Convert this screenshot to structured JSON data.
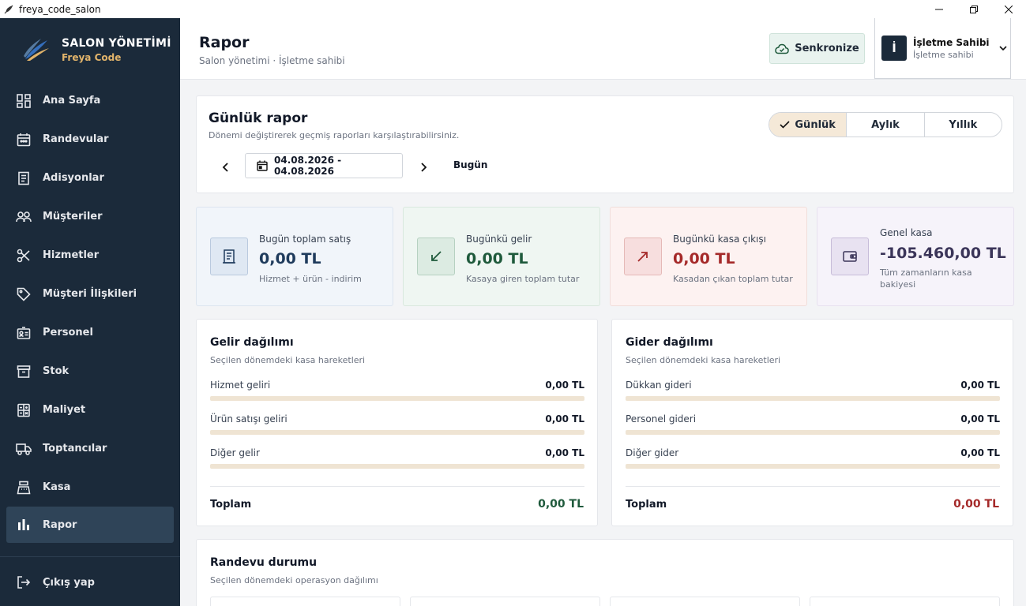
{
  "window": {
    "title": "freya_code_salon"
  },
  "brand": {
    "title": "SALON YÖNETİMİ",
    "subtitle": "Freya Code"
  },
  "sidebar": {
    "items": [
      {
        "label": "Ana Sayfa",
        "icon": "dashboard-icon"
      },
      {
        "label": "Randevular",
        "icon": "calendar-icon"
      },
      {
        "label": "Adisyonlar",
        "icon": "receipt-icon"
      },
      {
        "label": "Müşteriler",
        "icon": "users-icon"
      },
      {
        "label": "Hizmetler",
        "icon": "scissors-icon"
      },
      {
        "label": "Müşteri İlişkileri",
        "icon": "tag-icon"
      },
      {
        "label": "Personel",
        "icon": "id-card-icon"
      },
      {
        "label": "Stok",
        "icon": "archive-icon"
      },
      {
        "label": "Maliyet",
        "icon": "calculator-icon"
      },
      {
        "label": "Toptancılar",
        "icon": "truck-icon"
      },
      {
        "label": "Kasa",
        "icon": "cash-register-icon"
      },
      {
        "label": "Rapor",
        "icon": "bar-chart-icon",
        "active": true
      }
    ],
    "logout_label": "Çıkış yap"
  },
  "header": {
    "title": "Rapor",
    "subtitle": "Salon yönetimi · İşletme sahibi",
    "sync_label": "Senkronize",
    "user": {
      "initial": "İ",
      "name": "İşletme Sahibi",
      "role": "İşletme sahibi"
    }
  },
  "report": {
    "title": "Günlük rapor",
    "subtitle": "Dönemi değiştirerek geçmiş raporları karşılaştırabilirsiniz.",
    "periods": [
      "Günlük",
      "Aylık",
      "Yıllık"
    ],
    "active_period": "Günlük",
    "date_range": "04.08.2026 - 04.08.2026",
    "today_label": "Bugün"
  },
  "stats": [
    {
      "label": "Bugün toplam satış",
      "value": "0,00 TL",
      "note": "Hizmet + ürün - indirim"
    },
    {
      "label": "Bugünkü gelir",
      "value": "0,00 TL",
      "note": "Kasaya giren toplam tutar"
    },
    {
      "label": "Bugünkü kasa çıkışı",
      "value": "0,00 TL",
      "note": "Kasadan çıkan toplam tutar"
    },
    {
      "label": "Genel kasa",
      "value": "-105.460,00 TL",
      "note": "Tüm zamanların kasa bakiyesi"
    }
  ],
  "income": {
    "title": "Gelir dağılımı",
    "subtitle": "Seçilen dönemdeki kasa hareketleri",
    "rows": [
      {
        "label": "Hizmet geliri",
        "value": "0,00 TL",
        "fraction": 0
      },
      {
        "label": "Ürün satışı geliri",
        "value": "0,00 TL",
        "fraction": 0
      },
      {
        "label": "Diğer gelir",
        "value": "0,00 TL",
        "fraction": 0
      }
    ],
    "total_label": "Toplam",
    "total_value": "0,00 TL"
  },
  "expense": {
    "title": "Gider dağılımı",
    "subtitle": "Seçilen dönemdeki kasa hareketleri",
    "rows": [
      {
        "label": "Dükkan gideri",
        "value": "0,00 TL",
        "fraction": 0
      },
      {
        "label": "Personel gideri",
        "value": "0,00 TL",
        "fraction": 0
      },
      {
        "label": "Diğer gider",
        "value": "0,00 TL",
        "fraction": 0
      }
    ],
    "total_label": "Toplam",
    "total_value": "0,00 TL"
  },
  "appointments": {
    "title": "Randevu durumu",
    "subtitle": "Seçilen dönemdeki operasyon dağılımı"
  },
  "colors": {
    "sidebar_bg": "#1b2a3a",
    "accent_gold": "#e2b46b",
    "income_green": "#1f5a3c",
    "expense_red": "#a52a2a"
  }
}
